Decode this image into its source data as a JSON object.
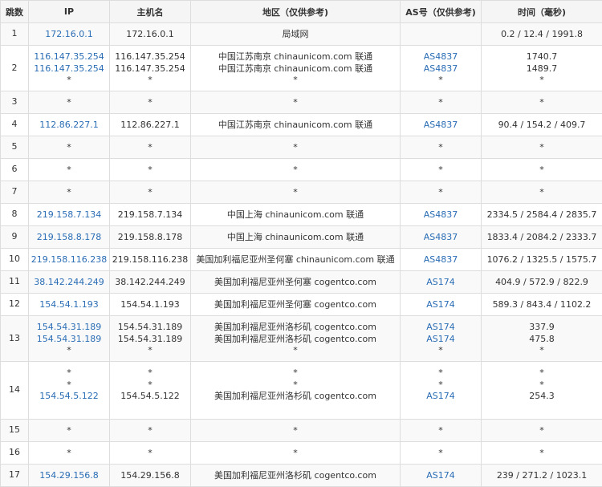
{
  "headers": {
    "hop": "跳数",
    "ip": "IP",
    "host": "主机名",
    "region": "地区（仅供参考)",
    "as": "AS号（仅供参考)",
    "time": "时间（毫秒)"
  },
  "rows": [
    {
      "hop": "1",
      "ip": [
        "172.16.0.1"
      ],
      "host": [
        "172.16.0.1"
      ],
      "region": [
        "局域网"
      ],
      "as": [
        ""
      ],
      "time": [
        "0.2 / 12.4 / 1991.8"
      ]
    },
    {
      "hop": "2",
      "ip": [
        "116.147.35.254",
        "116.147.35.254",
        "*"
      ],
      "host": [
        "116.147.35.254",
        "116.147.35.254",
        "*"
      ],
      "region": [
        "中国江苏南京 chinaunicom.com 联通",
        "中国江苏南京 chinaunicom.com 联通",
        "*"
      ],
      "as": [
        "AS4837",
        "AS4837",
        "*"
      ],
      "time": [
        "1740.7",
        "1489.7",
        "*"
      ]
    },
    {
      "hop": "3",
      "ip": [
        "*"
      ],
      "host": [
        "*"
      ],
      "region": [
        "*"
      ],
      "as": [
        "*"
      ],
      "time": [
        "*"
      ]
    },
    {
      "hop": "4",
      "ip": [
        "112.86.227.1"
      ],
      "host": [
        "112.86.227.1"
      ],
      "region": [
        "中国江苏南京 chinaunicom.com 联通"
      ],
      "as": [
        "AS4837"
      ],
      "time": [
        "90.4 / 154.2 / 409.7"
      ]
    },
    {
      "hop": "5",
      "ip": [
        "*"
      ],
      "host": [
        "*"
      ],
      "region": [
        "*"
      ],
      "as": [
        "*"
      ],
      "time": [
        "*"
      ]
    },
    {
      "hop": "6",
      "ip": [
        "*"
      ],
      "host": [
        "*"
      ],
      "region": [
        "*"
      ],
      "as": [
        "*"
      ],
      "time": [
        "*"
      ]
    },
    {
      "hop": "7",
      "ip": [
        "*"
      ],
      "host": [
        "*"
      ],
      "region": [
        "*"
      ],
      "as": [
        "*"
      ],
      "time": [
        "*"
      ]
    },
    {
      "hop": "8",
      "ip": [
        "219.158.7.134"
      ],
      "host": [
        "219.158.7.134"
      ],
      "region": [
        "中国上海 chinaunicom.com 联通"
      ],
      "as": [
        "AS4837"
      ],
      "time": [
        "2334.5 / 2584.4 / 2835.7"
      ]
    },
    {
      "hop": "9",
      "ip": [
        "219.158.8.178"
      ],
      "host": [
        "219.158.8.178"
      ],
      "region": [
        "中国上海 chinaunicom.com 联通"
      ],
      "as": [
        "AS4837"
      ],
      "time": [
        "1833.4 / 2084.2 / 2333.7"
      ]
    },
    {
      "hop": "10",
      "ip": [
        "219.158.116.238"
      ],
      "host": [
        "219.158.116.238"
      ],
      "region": [
        "美国加利福尼亚州圣何塞 chinaunicom.com 联通"
      ],
      "as": [
        "AS4837"
      ],
      "time": [
        "1076.2 / 1325.5 / 1575.7"
      ]
    },
    {
      "hop": "11",
      "ip": [
        "38.142.244.249"
      ],
      "host": [
        "38.142.244.249"
      ],
      "region": [
        "美国加利福尼亚州圣何塞 cogentco.com"
      ],
      "as": [
        "AS174"
      ],
      "time": [
        "404.9 / 572.9 / 822.9"
      ]
    },
    {
      "hop": "12",
      "ip": [
        "154.54.1.193"
      ],
      "host": [
        "154.54.1.193"
      ],
      "region": [
        "美国加利福尼亚州圣何塞 cogentco.com"
      ],
      "as": [
        "AS174"
      ],
      "time": [
        "589.3 / 843.4 / 1102.2"
      ]
    },
    {
      "hop": "13",
      "ip": [
        "154.54.31.189",
        "154.54.31.189",
        "*"
      ],
      "host": [
        "154.54.31.189",
        "154.54.31.189",
        "*"
      ],
      "region": [
        "美国加利福尼亚州洛杉矶 cogentco.com",
        "美国加利福尼亚州洛杉矶 cogentco.com",
        "*"
      ],
      "as": [
        "AS174",
        "AS174",
        "*"
      ],
      "time": [
        "337.9",
        "475.8",
        "*"
      ]
    },
    {
      "hop": "14",
      "ip": [
        "*",
        "*",
        "154.54.5.122"
      ],
      "host": [
        "*",
        "*",
        "154.54.5.122"
      ],
      "region": [
        "*",
        "*",
        "美国加利福尼亚州洛杉矶 cogentco.com"
      ],
      "as": [
        "*",
        "*",
        "AS174"
      ],
      "time": [
        "*",
        "*",
        "254.3"
      ]
    },
    {
      "hop": "15",
      "ip": [
        "*"
      ],
      "host": [
        "*"
      ],
      "region": [
        "*"
      ],
      "as": [
        "*"
      ],
      "time": [
        "*"
      ]
    },
    {
      "hop": "16",
      "ip": [
        "*"
      ],
      "host": [
        "*"
      ],
      "region": [
        "*"
      ],
      "as": [
        "*"
      ],
      "time": [
        "*"
      ]
    },
    {
      "hop": "17",
      "ip": [
        "154.29.156.8"
      ],
      "host": [
        "154.29.156.8"
      ],
      "region": [
        "美国加利福尼亚州洛杉矶 cogentco.com"
      ],
      "as": [
        "AS174"
      ],
      "time": [
        "239 / 271.2 / 1023.1"
      ]
    }
  ],
  "colors": {
    "link": "#2a6db5",
    "text": "#333333",
    "border": "#dddddd",
    "row_alt": "#f9f9f9"
  }
}
